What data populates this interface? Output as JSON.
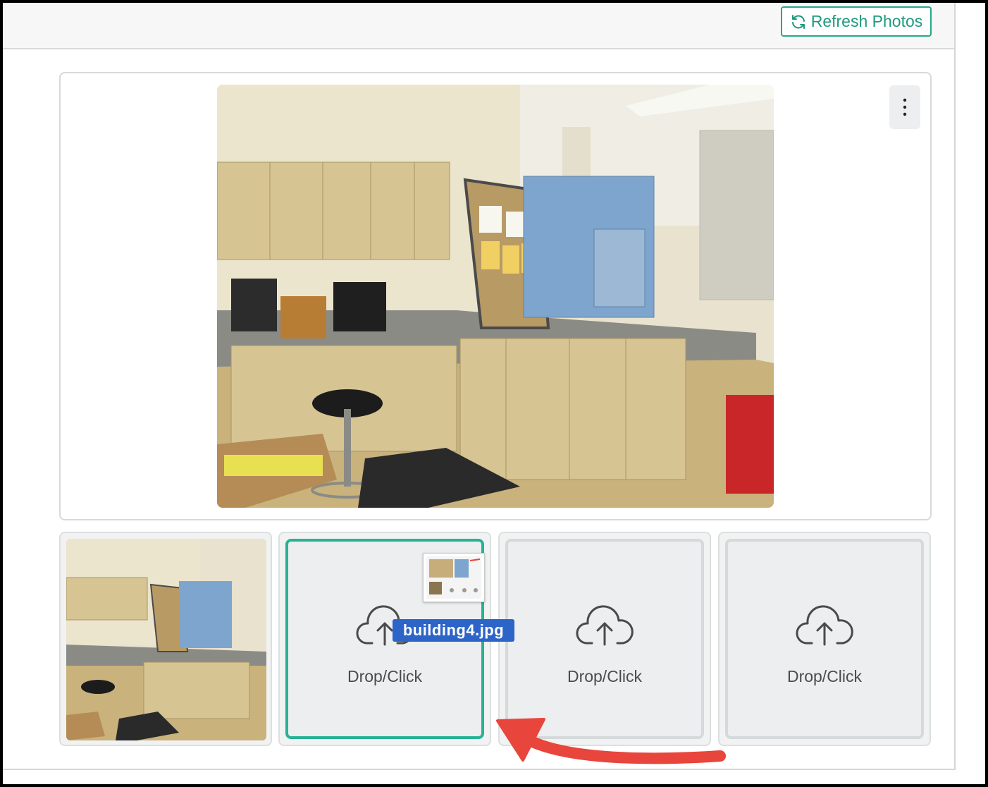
{
  "toolbar": {
    "refresh_label": "Refresh Photos",
    "refresh_icon": "refresh-icon",
    "accent_color": "#26a88a"
  },
  "main_photo": {
    "alt": "building4.jpg"
  },
  "slots": [
    {
      "type": "photo"
    },
    {
      "type": "empty",
      "label": "Drop/Click",
      "active": true
    },
    {
      "type": "empty",
      "label": "Drop/Click"
    },
    {
      "type": "empty",
      "label": "Drop/Click"
    }
  ],
  "drag": {
    "filename": "building4.jpg",
    "highlight_color": "#2d64c8"
  },
  "annotation": {
    "arrow_color": "#e8453c"
  }
}
